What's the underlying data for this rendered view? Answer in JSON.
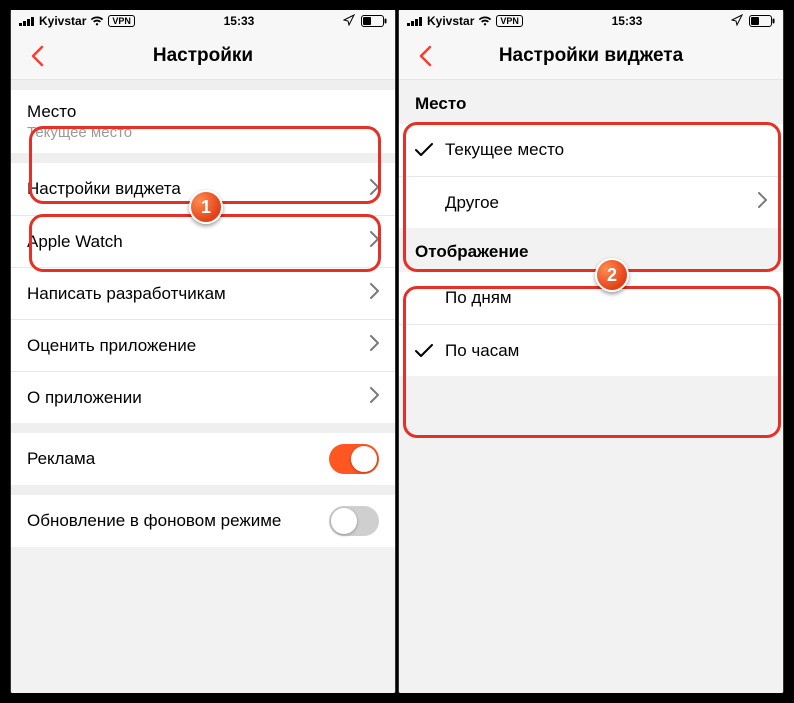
{
  "status": {
    "carrier": "Kyivstar",
    "vpn": "VPN",
    "time": "15:33"
  },
  "left": {
    "title": "Настройки",
    "location_label": "Место",
    "location_value": "Текущее место",
    "rows": {
      "widget": "Настройки виджета",
      "apple_watch": "Apple Watch",
      "contact": "Написать разработчикам",
      "rate": "Оценить приложение",
      "about": "О приложении",
      "ads": "Реклама",
      "background": "Обновление в фоновом режиме"
    }
  },
  "right": {
    "title": "Настройки виджета",
    "section_location": "Место",
    "opt_current": "Текущее место",
    "opt_other": "Другое",
    "section_display": "Отображение",
    "opt_days": "По дням",
    "opt_hours": "По часам"
  },
  "badges": {
    "one": "1",
    "two": "2"
  }
}
